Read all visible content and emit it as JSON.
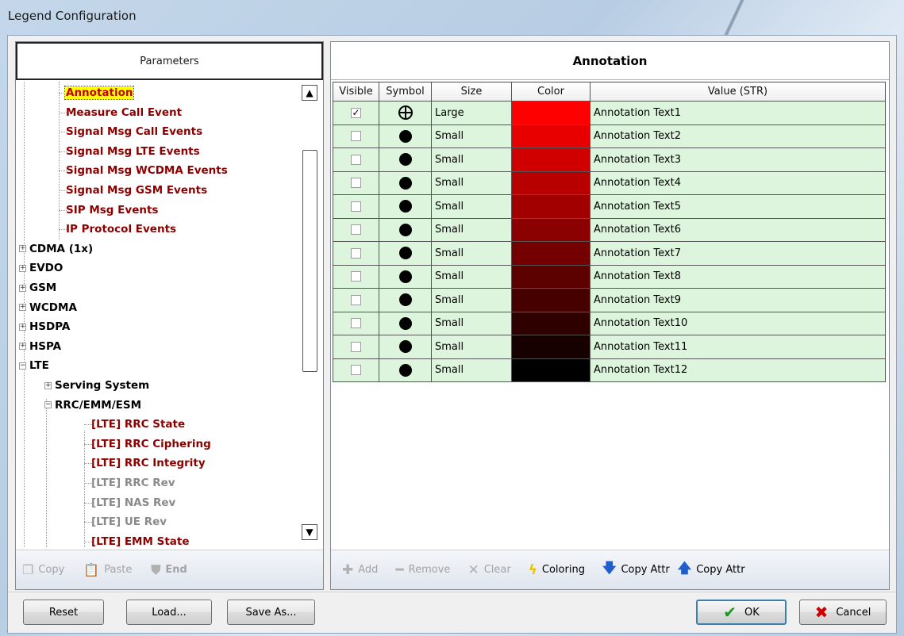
{
  "window": {
    "title": "Legend Configuration"
  },
  "left": {
    "header": "Parameters",
    "tree": [
      {
        "label": "Annotation",
        "style": "sel",
        "indent": 2
      },
      {
        "label": "Measure Call Event",
        "style": "red",
        "indent": 2
      },
      {
        "label": "Signal Msg Call Events",
        "style": "red",
        "indent": 2
      },
      {
        "label": "Signal Msg LTE Events",
        "style": "red",
        "indent": 2
      },
      {
        "label": "Signal Msg WCDMA Events",
        "style": "red",
        "indent": 2
      },
      {
        "label": "Signal Msg GSM Events",
        "style": "red",
        "indent": 2
      },
      {
        "label": "SIP Msg Events",
        "style": "red",
        "indent": 2
      },
      {
        "label": "IP Protocol Events",
        "style": "red",
        "indent": 2
      },
      {
        "label": "CDMA (1x)",
        "style": "black",
        "indent": 0,
        "expander": "+"
      },
      {
        "label": "EVDO",
        "style": "black",
        "indent": 0,
        "expander": "+"
      },
      {
        "label": "GSM",
        "style": "black",
        "indent": 0,
        "expander": "+"
      },
      {
        "label": "WCDMA",
        "style": "black",
        "indent": 0,
        "expander": "+"
      },
      {
        "label": "HSDPA",
        "style": "black",
        "indent": 0,
        "expander": "+"
      },
      {
        "label": "HSPA",
        "style": "black",
        "indent": 0,
        "expander": "+"
      },
      {
        "label": "LTE",
        "style": "black",
        "indent": 0,
        "expander": "-"
      },
      {
        "label": "Serving System",
        "style": "black",
        "indent": 1,
        "expander": "+"
      },
      {
        "label": "RRC/EMM/ESM",
        "style": "black",
        "indent": 1,
        "expander": "-"
      },
      {
        "label": "[LTE] RRC State",
        "style": "red",
        "indent": 3
      },
      {
        "label": "[LTE] RRC Ciphering",
        "style": "red",
        "indent": 3
      },
      {
        "label": "[LTE] RRC Integrity",
        "style": "red",
        "indent": 3
      },
      {
        "label": "[LTE] RRC Rev",
        "style": "gray",
        "indent": 3
      },
      {
        "label": "[LTE] NAS Rev",
        "style": "gray",
        "indent": 3
      },
      {
        "label": "[LTE] UE Rev",
        "style": "gray",
        "indent": 3
      },
      {
        "label": "[LTE] EMM State",
        "style": "red",
        "indent": 3
      }
    ],
    "toolbar": {
      "copy": "Copy",
      "paste": "Paste",
      "end": "End"
    }
  },
  "right": {
    "header": "Annotation",
    "columns": [
      "Visible",
      "Symbol",
      "Size",
      "Color",
      "Value (STR)"
    ],
    "rows": [
      {
        "visible": true,
        "symbol": "crosshair-circle",
        "size": "Large",
        "color": "#ff0000",
        "value": "Annotation Text1"
      },
      {
        "visible": false,
        "symbol": "filled-circle",
        "size": "Small",
        "color": "#e80000",
        "value": "Annotation Text2"
      },
      {
        "visible": false,
        "symbol": "filled-circle",
        "size": "Small",
        "color": "#d00000",
        "value": "Annotation Text3"
      },
      {
        "visible": false,
        "symbol": "filled-circle",
        "size": "Small",
        "color": "#b90000",
        "value": "Annotation Text4"
      },
      {
        "visible": false,
        "symbol": "filled-circle",
        "size": "Small",
        "color": "#a20000",
        "value": "Annotation Text5"
      },
      {
        "visible": false,
        "symbol": "filled-circle",
        "size": "Small",
        "color": "#8b0000",
        "value": "Annotation Text6"
      },
      {
        "visible": false,
        "symbol": "filled-circle",
        "size": "Small",
        "color": "#740000",
        "value": "Annotation Text7"
      },
      {
        "visible": false,
        "symbol": "filled-circle",
        "size": "Small",
        "color": "#5d0000",
        "value": "Annotation Text8"
      },
      {
        "visible": false,
        "symbol": "filled-circle",
        "size": "Small",
        "color": "#460000",
        "value": "Annotation Text9"
      },
      {
        "visible": false,
        "symbol": "filled-circle",
        "size": "Small",
        "color": "#2e0000",
        "value": "Annotation Text10"
      },
      {
        "visible": false,
        "symbol": "filled-circle",
        "size": "Small",
        "color": "#170000",
        "value": "Annotation Text11"
      },
      {
        "visible": false,
        "symbol": "filled-circle",
        "size": "Small",
        "color": "#000000",
        "value": "Annotation Text12"
      }
    ],
    "toolbar": {
      "add": "Add",
      "remove": "Remove",
      "clear": "Clear",
      "coloring": "Coloring",
      "copy_attr_down": "Copy Attr",
      "copy_attr_up": "Copy Attr"
    }
  },
  "buttons": {
    "reset": "Reset",
    "load": "Load...",
    "save_as": "Save As...",
    "ok": "OK",
    "cancel": "Cancel"
  }
}
